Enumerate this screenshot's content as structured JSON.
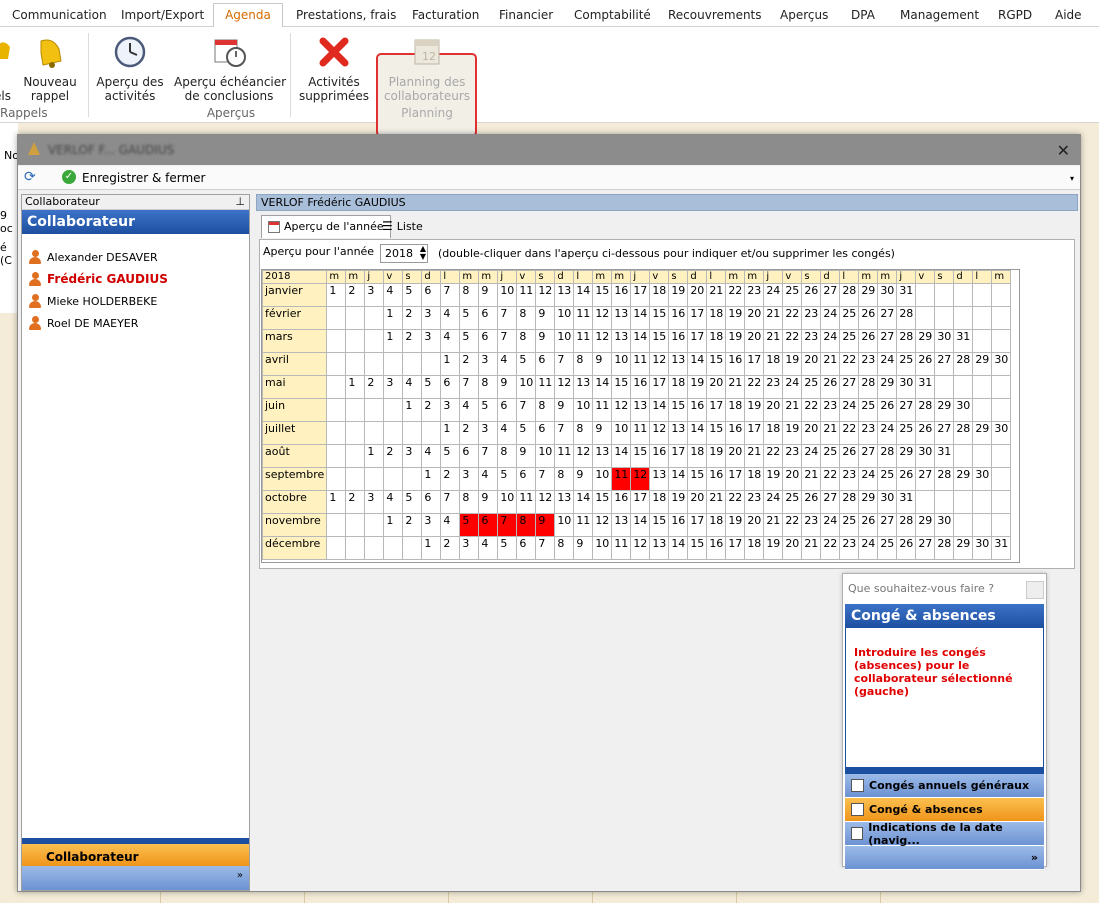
{
  "menu": [
    "Communication",
    "Import/Export",
    "Agenda",
    "Prestations, frais",
    "Facturation",
    "Financier",
    "Comptabilité",
    "Recouvrements",
    "Aperçus",
    "DPA",
    "Management",
    "RGPD",
    "Aide"
  ],
  "ribbon": {
    "partial_label": "s\nels",
    "new_reminder": "Nouveau\nrappel",
    "group_rappels": "Rappels",
    "activities": "Aperçu des\nactivités",
    "deadlines": "Aperçu échéancier\nde conclusions",
    "group_apercus": "Aperçus",
    "deleted": "Activités\nsupprimées",
    "planning": "Planning des\ncollaborateurs",
    "group_planning": "Planning"
  },
  "left_strip": [
    "No",
    "9 oc",
    "é (C"
  ],
  "dialog": {
    "title": "VERLOF F... GAUDIUS",
    "save_close": "Enregistrer & fermer"
  },
  "left_panel": {
    "header": "Collaborateur",
    "title": "Collaborateur",
    "people": [
      {
        "name": "Alexander DESAVER"
      },
      {
        "name": "Frédéric GAUDIUS"
      },
      {
        "name": "Mieke HOLDERBEKE"
      },
      {
        "name": "Roel DE MAEYER"
      }
    ],
    "footer": "Collaborateur"
  },
  "right_panel": {
    "header": "VERLOF Frédéric GAUDIUS",
    "tab_year": "Aperçu de l'année",
    "tab_list": "Liste",
    "year_label": "Aperçu pour l'année",
    "year_value": "2018",
    "hint": "(double-cliquer dans l'aperçu ci-dessous pour indiquer et/ou supprimer les congés)"
  },
  "calendar": {
    "year": "2018",
    "weekday_headers": [
      "m",
      "m",
      "j",
      "v",
      "s",
      "d",
      "l",
      "m",
      "m",
      "j",
      "v",
      "s",
      "d",
      "l",
      "m",
      "m",
      "j",
      "v",
      "s",
      "d",
      "l",
      "m",
      "m",
      "j",
      "v",
      "s",
      "d",
      "l",
      "m",
      "m",
      "j",
      "v",
      "s",
      "d",
      "l",
      "m"
    ],
    "months": [
      {
        "name": "janvier",
        "offset": 0,
        "days": 31,
        "red": []
      },
      {
        "name": "février",
        "offset": 3,
        "days": 28,
        "red": []
      },
      {
        "name": "mars",
        "offset": 3,
        "days": 31,
        "red": []
      },
      {
        "name": "avril",
        "offset": 6,
        "days": 30,
        "red": []
      },
      {
        "name": "mai",
        "offset": 1,
        "days": 31,
        "red": []
      },
      {
        "name": "juin",
        "offset": 4,
        "days": 30,
        "red": []
      },
      {
        "name": "juillet",
        "offset": 6,
        "days": 31,
        "red": []
      },
      {
        "name": "août",
        "offset": 2,
        "days": 31,
        "red": []
      },
      {
        "name": "septembre",
        "offset": 5,
        "days": 30,
        "red": [
          11,
          12
        ]
      },
      {
        "name": "octobre",
        "offset": 0,
        "days": 31,
        "red": []
      },
      {
        "name": "novembre",
        "offset": 3,
        "days": 30,
        "red": [
          5,
          6,
          7,
          8,
          9
        ]
      },
      {
        "name": "décembre",
        "offset": 5,
        "days": 31,
        "red": []
      }
    ]
  },
  "helper": {
    "question": "Que souhaitez-vous faire ?",
    "title": "Congé & absences",
    "text": "Introduire les congés (absences) pour le collaborateur sélectionné (gauche)",
    "items": [
      "Congés annuels généraux",
      "Congé & absences",
      "Indications de la date (navig..."
    ]
  }
}
